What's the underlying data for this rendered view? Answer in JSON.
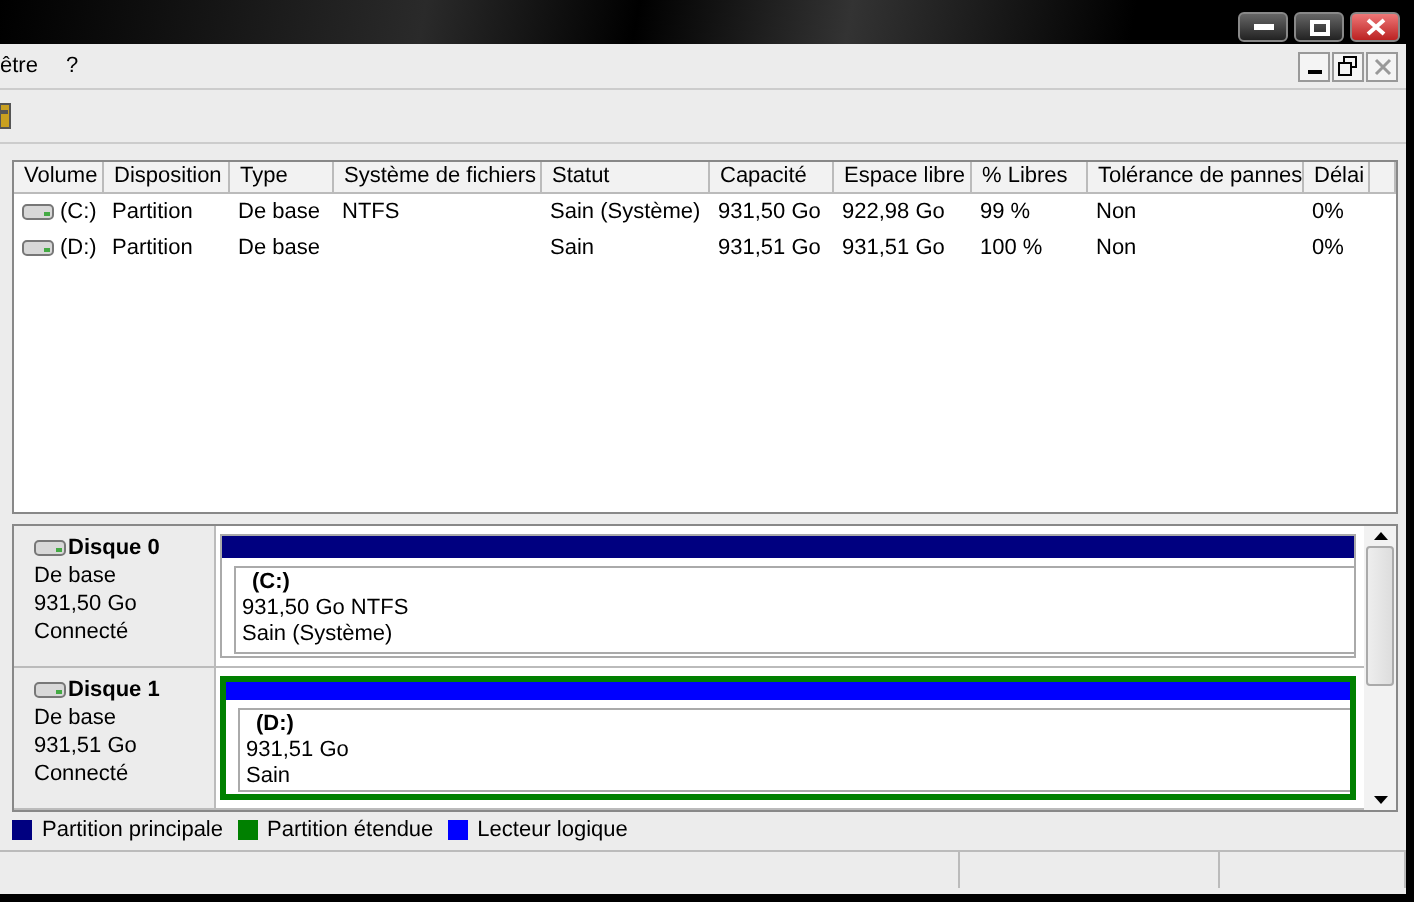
{
  "menu": [
    "être",
    "?"
  ],
  "table": {
    "columns": [
      "Volume",
      "Disposition",
      "Type",
      "Système de fichiers",
      "Statut",
      "Capacité",
      "Espace libre",
      "% Libres",
      "Tolérance de pannes",
      "Délai"
    ],
    "rows": [
      {
        "cells": [
          "(C:)",
          "Partition",
          "De base",
          "NTFS",
          "Sain (Système)",
          "931,50 Go",
          "922,98 Go",
          "99 %",
          "Non",
          "0%"
        ]
      },
      {
        "cells": [
          "(D:)",
          "Partition",
          "De base",
          "",
          "Sain",
          "931,51 Go",
          "931,51 Go",
          "100 %",
          "Non",
          "0%"
        ]
      }
    ]
  },
  "disks": [
    {
      "name": "Disque 0",
      "type": "De base",
      "size": "931,50 Go",
      "state": "Connecté",
      "partition": {
        "kind": "primary",
        "label": "(C:)",
        "size": "931,50 Go NTFS",
        "status": "Sain (Système)"
      }
    },
    {
      "name": "Disque 1",
      "type": "De base",
      "size": "931,51 Go",
      "state": "Connecté",
      "partition": {
        "kind": "logical",
        "label": "(D:)",
        "size": "931,51 Go",
        "status": "Sain"
      }
    }
  ],
  "legend": [
    {
      "label": "Partition principale",
      "color": "#000080"
    },
    {
      "label": "Partition étendue",
      "color": "#008000"
    },
    {
      "label": "Lecteur logique",
      "color": "#0000ff"
    }
  ]
}
